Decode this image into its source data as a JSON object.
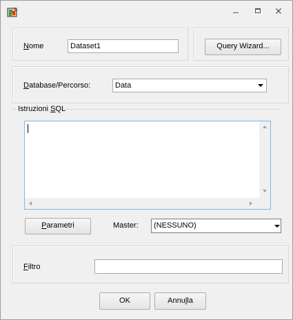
{
  "titlebar": {
    "icons": {
      "app": "app-icon",
      "minimize": "minimize-icon",
      "maximize": "maximize-icon",
      "close": "close-icon"
    }
  },
  "dataset": {
    "name_label_pre": "N",
    "name_label_post": "ome",
    "name_value": "Dataset1",
    "query_wizard_label": "Query Wizard..."
  },
  "database": {
    "label_pre": "D",
    "label_post": "atabase/Percorso:",
    "value": "Data"
  },
  "sql": {
    "label_pre": "Istruzioni ",
    "label_s": "S",
    "label_post": "QL",
    "text": "",
    "params_pre": "P",
    "params_post": "arametri",
    "master_label": "Master:",
    "master_value": "(NESSUNO)"
  },
  "filter": {
    "label_pre": "F",
    "label_post": "iltro",
    "value": ""
  },
  "buttons": {
    "ok": "OK",
    "cancel_pre": "Annu",
    "cancel_u": "l",
    "cancel_post": "la"
  },
  "colors": {
    "background": "#f0f0f0",
    "border": "#adadad",
    "focus_border": "#7eb4ea"
  }
}
